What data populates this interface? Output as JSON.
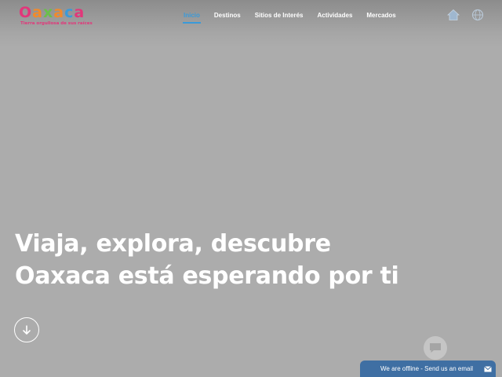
{
  "brand": {
    "logo_letters": [
      "O",
      "a",
      "x",
      "a",
      "c",
      "a"
    ],
    "logo_colors": [
      "#e2377a",
      "#f18a2b",
      "#6bbf4a",
      "#f18a2b",
      "#3a9ad9",
      "#e2377a"
    ],
    "tagline": "Tierra orgullosa de sus raíces"
  },
  "nav": {
    "items": [
      {
        "label": "Inicio",
        "active": true
      },
      {
        "label": "Destinos",
        "active": false
      },
      {
        "label": "Sitios de Interés",
        "active": false
      },
      {
        "label": "Actividades",
        "active": false
      },
      {
        "label": "Mercados",
        "active": false
      }
    ],
    "accent": "#3a9ad9"
  },
  "header_icons": [
    "home-icon",
    "globe-icon"
  ],
  "hero": {
    "line1": "Viaja, explora, descubre",
    "line2": "Oaxaca está esperando por ti",
    "scroll_icon": "arrow-down-icon"
  },
  "chat": {
    "bubble_icon": "chat-bubble-icon",
    "bar_text": "We are offline - Send us an email",
    "bar_icon": "envelope-icon",
    "bar_color": "#3f6fa3"
  }
}
